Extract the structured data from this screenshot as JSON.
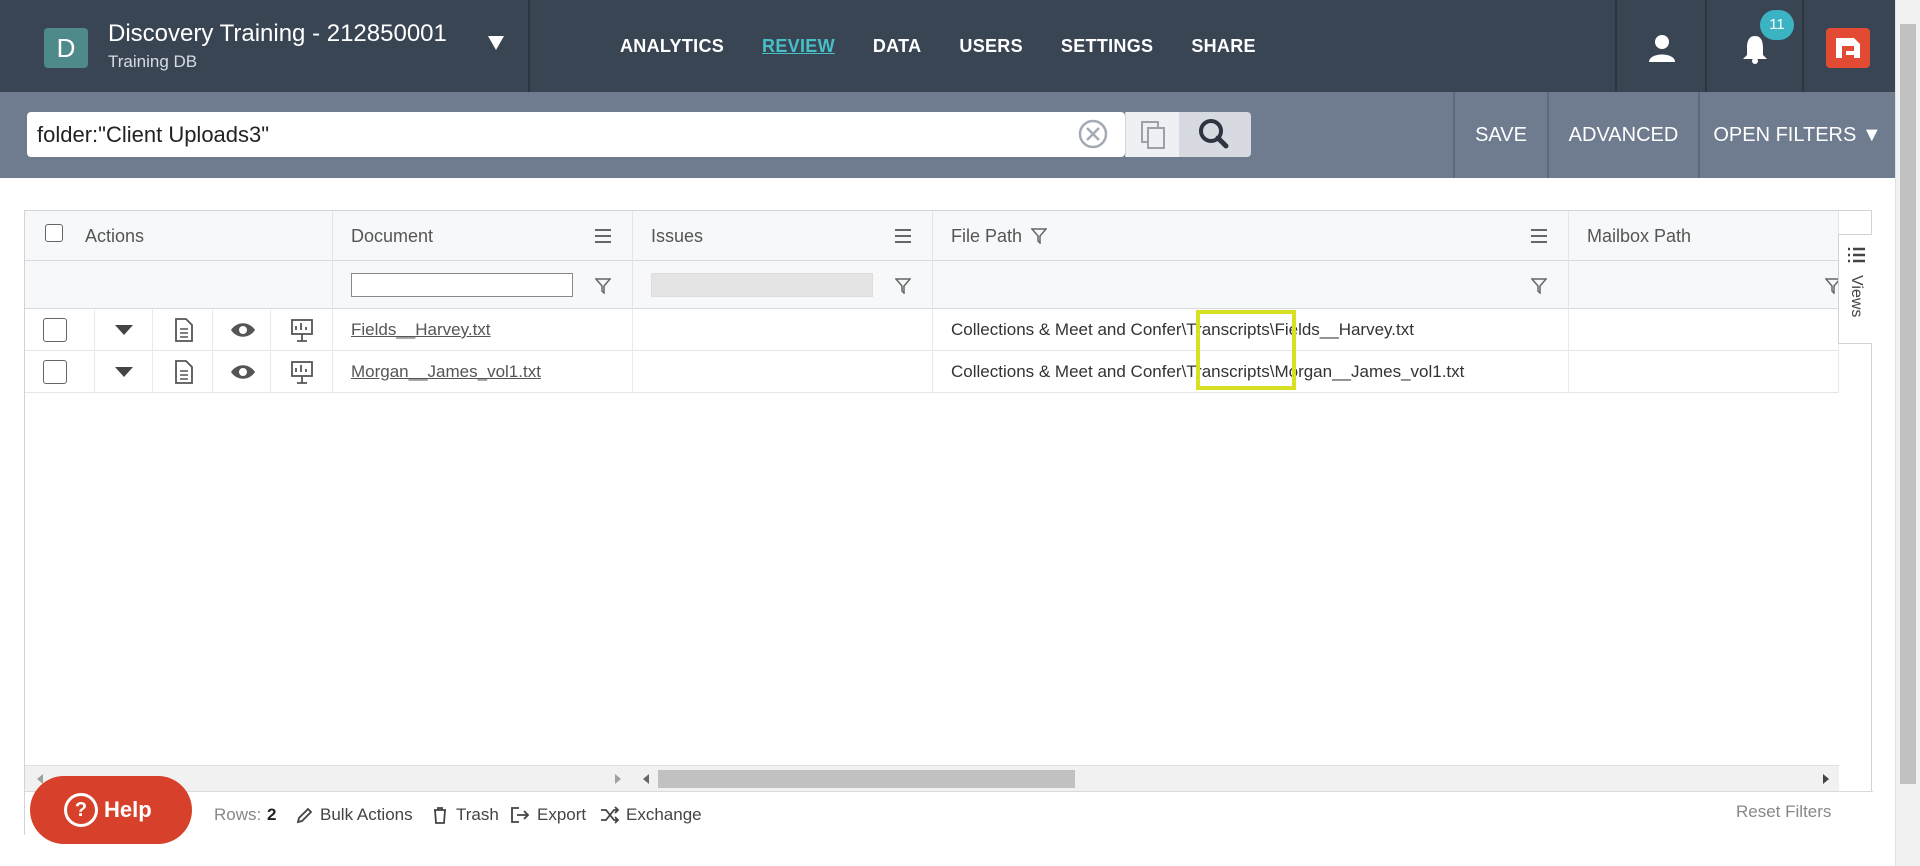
{
  "project": {
    "avatar_letter": "D",
    "title": "Discovery Training - 212850001",
    "subtitle": "Training DB"
  },
  "nav": {
    "items": [
      "ANALYTICS",
      "REVIEW",
      "DATA",
      "USERS",
      "SETTINGS",
      "SHARE"
    ],
    "active": "REVIEW"
  },
  "notifications": {
    "count": "11"
  },
  "search": {
    "query": "folder:\"Client Uploads3\""
  },
  "search_actions": {
    "save": "SAVE",
    "advanced": "ADVANCED",
    "open_filters": "OPEN FILTERS ▼"
  },
  "grid": {
    "columns": {
      "actions": "Actions",
      "document": "Document",
      "issues": "Issues",
      "file_path": "File Path",
      "mailbox_path": "Mailbox Path"
    },
    "rows": [
      {
        "document": "Fields__Harvey.txt",
        "issues": "",
        "file_path": "Collections & Meet and Confer\\Transcripts\\Fields__Harvey.txt",
        "mailbox_path": ""
      },
      {
        "document": "Morgan__James_vol1.txt",
        "issues": "",
        "file_path": "Collections & Meet and Confer\\Transcripts\\Morgan__James_vol1.txt",
        "mailbox_path": ""
      }
    ]
  },
  "views_tab": {
    "label": "Views"
  },
  "footer": {
    "help": "Help",
    "rows_label": "Rows:",
    "rows_count": "2",
    "bulk_actions": "Bulk Actions",
    "trash": "Trash",
    "export": "Export",
    "exchange": "Exchange",
    "reset_filters": "Reset Filters"
  },
  "colors": {
    "topbar": "#3a4554",
    "searchbar": "#6f7c90",
    "accent": "#46c0c8",
    "help": "#d7402a",
    "highlight": "#d7e023"
  }
}
